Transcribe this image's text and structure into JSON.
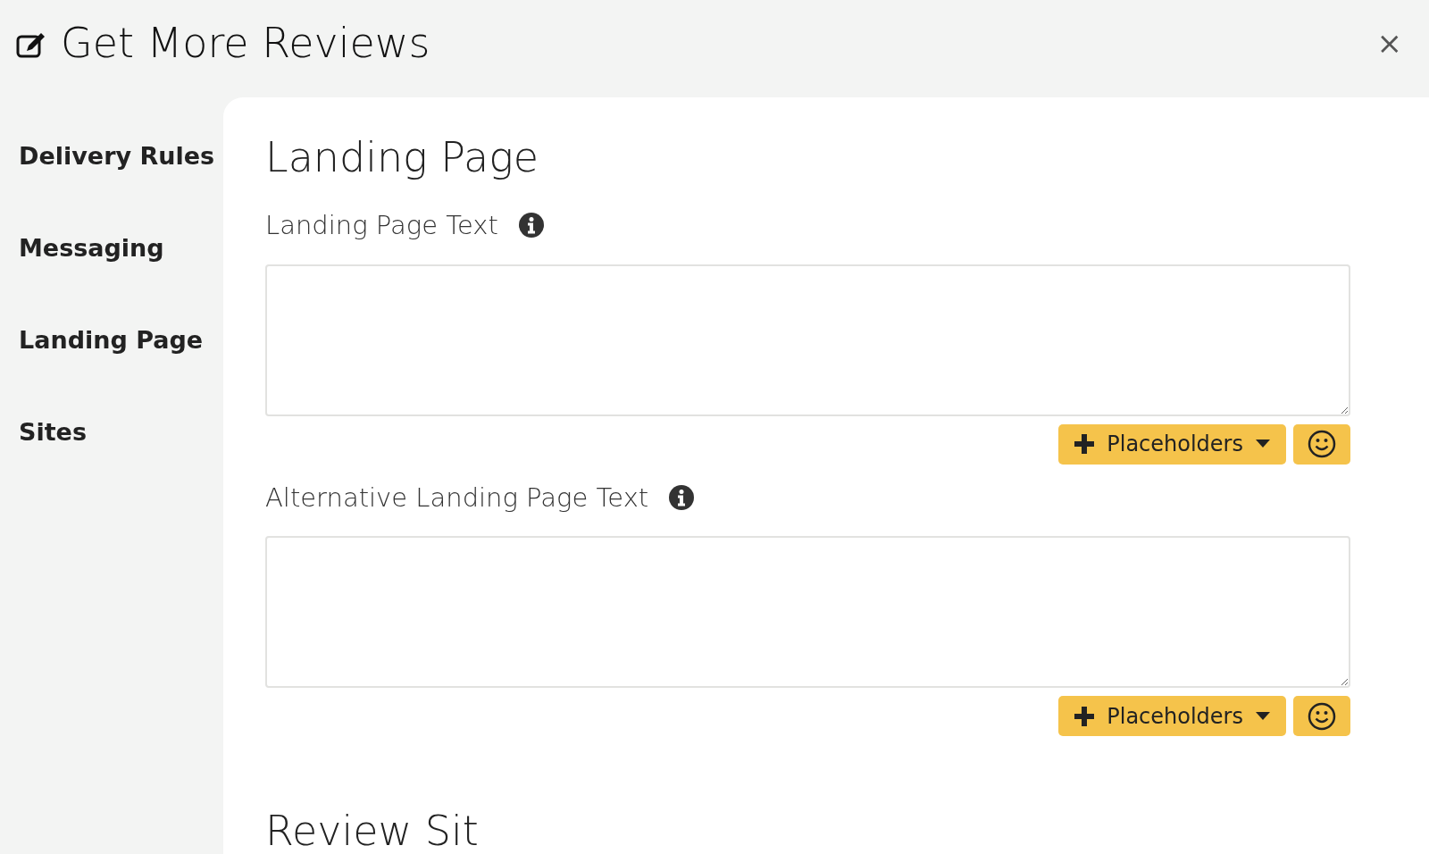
{
  "header": {
    "title": "Get More Reviews",
    "close": "×"
  },
  "sidebar": {
    "items": [
      {
        "label": "Delivery Rules"
      },
      {
        "label": "Messaging"
      },
      {
        "label": "Landing Page"
      },
      {
        "label": "Sites"
      }
    ]
  },
  "section": {
    "title": "Landing Page",
    "fields": [
      {
        "label": "Landing Page Text",
        "placeholders_button": "Placeholders"
      },
      {
        "label": "Alternative Landing Page Text",
        "placeholders_button": "Placeholders"
      }
    ]
  },
  "next_section": {
    "title": "Review Sit"
  }
}
